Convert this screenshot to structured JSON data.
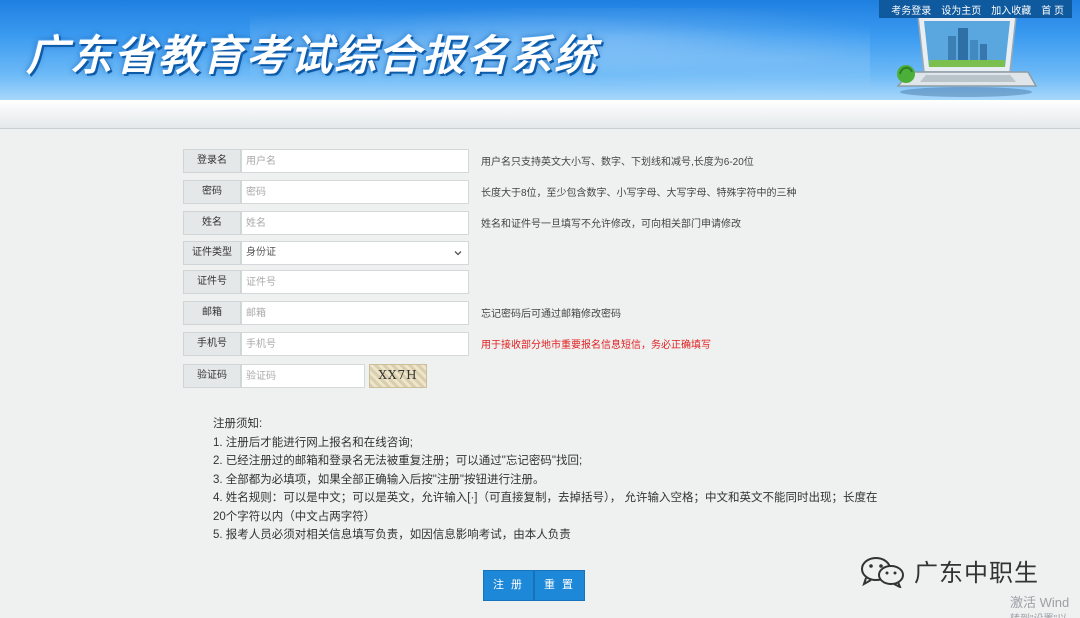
{
  "header": {
    "site_title": "广东省教育考试综合报名系统",
    "top_links": [
      "考务登录",
      "设为主页",
      "加入收藏",
      "首 页"
    ]
  },
  "form": {
    "username": {
      "label": "登录名",
      "placeholder": "用户名",
      "hint": "用户名只支持英文大小写、数字、下划线和减号,长度为6-20位"
    },
    "password": {
      "label": "密码",
      "placeholder": "密码",
      "hint": "长度大于8位，至少包含数字、小写字母、大写字母、特殊字符中的三种"
    },
    "name": {
      "label": "姓名",
      "placeholder": "姓名",
      "hint": "姓名和证件号一旦填写不允许修改，可向相关部门申请修改"
    },
    "id_type": {
      "label": "证件类型",
      "selected": "身份证"
    },
    "id_number": {
      "label": "证件号",
      "placeholder": "证件号"
    },
    "email": {
      "label": "邮箱",
      "placeholder": "邮箱",
      "hint": "忘记密码后可通过邮箱修改密码"
    },
    "phone": {
      "label": "手机号",
      "placeholder": "手机号",
      "hint": "用于接收部分地市重要报名信息短信，务必正确填写"
    },
    "captcha": {
      "label": "验证码",
      "placeholder": "验证码",
      "image_text": "XX7H"
    }
  },
  "notice": {
    "title": "注册须知:",
    "items": [
      "1. 注册后才能进行网上报名和在线咨询;",
      "2. 已经注册过的邮箱和登录名无法被重复注册；可以通过\"忘记密码\"找回;",
      "3. 全部都为必填项，如果全部正确输入后按\"注册\"按钮进行注册。",
      "4. 姓名规则：可以是中文；可以是英文，允许输入[·]（可直接复制，去掉括号），  允许输入空格；中文和英文不能同时出现；长度在",
      "20个字符以内（中文占两字符）",
      "5. 报考人员必须对相关信息填写负责，如因信息影响考试，由本人负责"
    ]
  },
  "buttons": {
    "register": "注 册",
    "reset": "重 置"
  },
  "watermark": {
    "wechat": "广东中职生",
    "activate": "激活 Wind",
    "activate_sub": "转到\"设置\"以"
  }
}
